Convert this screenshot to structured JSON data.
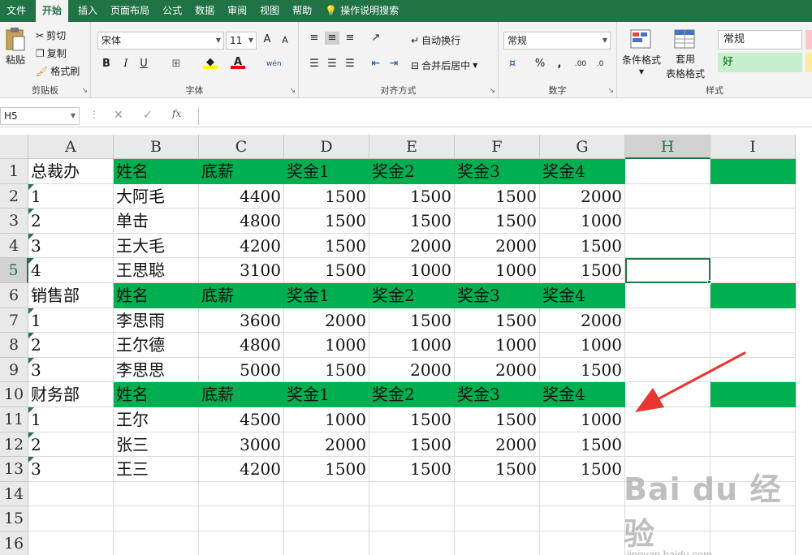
{
  "ribbon_tabs": [
    "文件",
    "开始",
    "插入",
    "页面布局",
    "公式",
    "数据",
    "审阅",
    "视图",
    "帮助",
    "操作说明搜索"
  ],
  "active_tab": "开始",
  "clipboard": {
    "paste": "粘贴",
    "cut": "剪切",
    "copy": "复制",
    "format_painter": "格式刷",
    "label": "剪贴板"
  },
  "font": {
    "name": "宋体",
    "size": "11",
    "label": "字体",
    "bold": "B",
    "italic": "I",
    "underline": "U",
    "grow": "A",
    "shrink": "A",
    "font_color": "A",
    "phonetic": "wén"
  },
  "alignment": {
    "wrap_text": "自动换行",
    "merge_center": "合并后居中",
    "label": "对齐方式"
  },
  "number": {
    "format": "常规",
    "label": "数字",
    "percent": "%",
    "comma": ",",
    "inc_decimal": ".00",
    "dec_decimal": ".0"
  },
  "styles": {
    "conditional": "条件格式",
    "table": "套用",
    "table2": "表格格式",
    "normal": "常规",
    "good": "好",
    "label": "样式"
  },
  "formula_bar": {
    "name_box": "H5",
    "cancel": "✕",
    "enter": "✓",
    "fx": "fx",
    "content": ""
  },
  "columns": [
    "A",
    "B",
    "C",
    "D",
    "E",
    "F",
    "G",
    "H",
    "I"
  ],
  "selected_col": "H",
  "selected_row": "5",
  "rows": [
    {
      "n": "1",
      "cells": [
        "总裁办",
        "姓名",
        "底薪",
        "奖金1",
        "奖金2",
        "奖金3",
        "奖金4",
        "",
        ""
      ]
    },
    {
      "n": "2",
      "cells": [
        "1",
        "大阿毛",
        "4400",
        "1500",
        "1500",
        "1500",
        "2000",
        "",
        ""
      ]
    },
    {
      "n": "3",
      "cells": [
        "2",
        "单击",
        "4800",
        "1500",
        "1500",
        "1500",
        "1000",
        "",
        ""
      ]
    },
    {
      "n": "4",
      "cells": [
        "3",
        "王大毛",
        "4200",
        "1500",
        "2000",
        "2000",
        "1500",
        "",
        ""
      ]
    },
    {
      "n": "5",
      "cells": [
        "4",
        "王思聪",
        "3100",
        "1500",
        "1000",
        "1000",
        "1500",
        "",
        ""
      ]
    },
    {
      "n": "6",
      "cells": [
        "销售部",
        "姓名",
        "底薪",
        "奖金1",
        "奖金2",
        "奖金3",
        "奖金4",
        "",
        ""
      ]
    },
    {
      "n": "7",
      "cells": [
        "1",
        "李思雨",
        "3600",
        "2000",
        "1500",
        "1500",
        "2000",
        "",
        ""
      ]
    },
    {
      "n": "8",
      "cells": [
        "2",
        "王尔德",
        "4800",
        "1000",
        "1000",
        "1000",
        "1000",
        "",
        ""
      ]
    },
    {
      "n": "9",
      "cells": [
        "3",
        "李思思",
        "5000",
        "1500",
        "2000",
        "2000",
        "1500",
        "",
        ""
      ]
    },
    {
      "n": "10",
      "cells": [
        "财务部",
        "姓名",
        "底薪",
        "奖金1",
        "奖金2",
        "奖金3",
        "奖金4",
        "",
        ""
      ]
    },
    {
      "n": "11",
      "cells": [
        "1",
        "王尔",
        "4500",
        "1000",
        "1500",
        "1500",
        "1000",
        "",
        ""
      ]
    },
    {
      "n": "12",
      "cells": [
        "2",
        "张三",
        "3000",
        "2000",
        "1500",
        "2000",
        "1500",
        "",
        ""
      ]
    },
    {
      "n": "13",
      "cells": [
        "3",
        "王三",
        "4200",
        "1500",
        "1500",
        "1500",
        "1500",
        "",
        ""
      ]
    },
    {
      "n": "14",
      "cells": [
        "",
        "",
        "",
        "",
        "",
        "",
        "",
        "",
        ""
      ]
    },
    {
      "n": "15",
      "cells": [
        "",
        "",
        "",
        "",
        "",
        "",
        "",
        "",
        ""
      ]
    },
    {
      "n": "16",
      "cells": [
        "",
        "",
        "",
        "",
        "",
        "",
        "",
        "",
        ""
      ]
    }
  ],
  "header_rows": [
    "1",
    "6",
    "10"
  ],
  "colors": {
    "excel_green": "#217346",
    "header_fill": "#00b050",
    "arrow": "#e8372f",
    "good_fill": "#c6efce",
    "good_text": "#006100"
  },
  "watermark": {
    "logo": "Bai du 经验",
    "url": "jingyan.baidu.com"
  }
}
